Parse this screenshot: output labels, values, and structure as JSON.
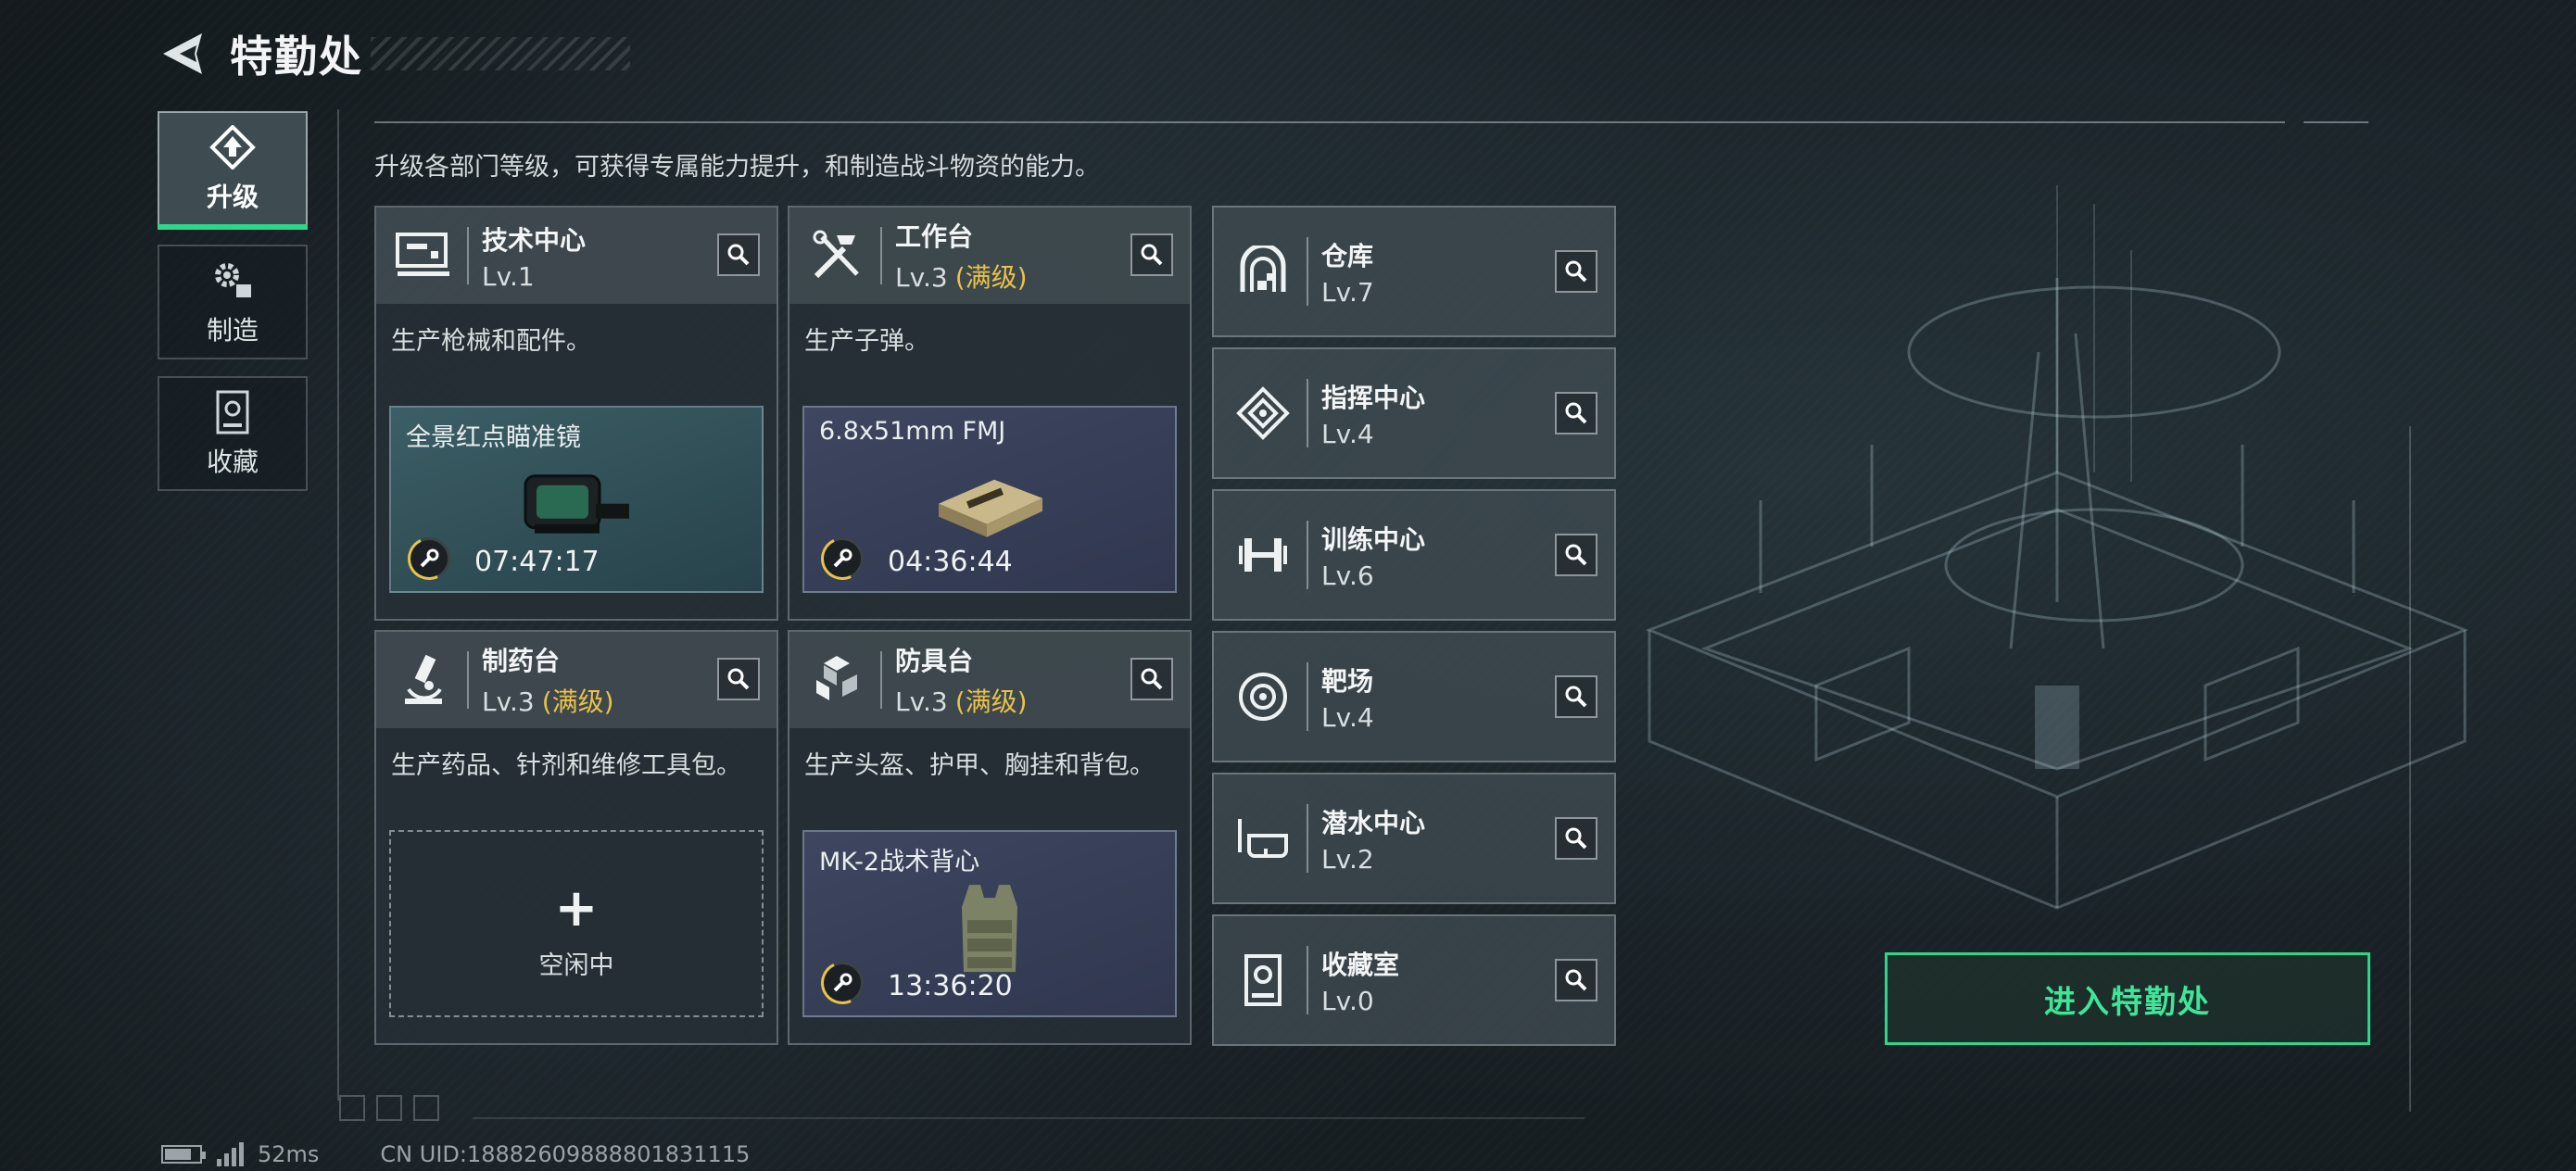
{
  "header": {
    "title": "特勤处",
    "back_icon": "back-arrow-icon"
  },
  "tabs": [
    {
      "label": "升级",
      "icon": "upgrade-icon",
      "active": true
    },
    {
      "label": "制造",
      "icon": "gears-icon",
      "active": false
    },
    {
      "label": "收藏",
      "icon": "collection-icon",
      "active": false
    }
  ],
  "description": "升级各部门等级，可获得专属能力提升，和制造战斗物资的能力。",
  "facilities": [
    {
      "name": "技术中心",
      "level": "Lv.1",
      "maxed": "",
      "icon": "monitor-icon",
      "desc": "生产枪械和配件。",
      "slot": {
        "item": "全景红点瞄准镜",
        "timer": "07:47:17",
        "item_icon": "red-dot-sight-icon"
      }
    },
    {
      "name": "工作台",
      "level": "Lv.3",
      "maxed": "(满级)",
      "icon": "tools-icon",
      "desc": "生产子弹。",
      "slot": {
        "item": "6.8x51mm FMJ",
        "timer": "04:36:44",
        "item_icon": "ammo-box-icon"
      }
    },
    {
      "name": "制药台",
      "level": "Lv.3",
      "maxed": "(满级)",
      "icon": "microscope-icon",
      "desc": "生产药品、针剂和维修工具包。",
      "slot": {
        "empty": true,
        "empty_label": "空闲中"
      }
    },
    {
      "name": "防具台",
      "level": "Lv.3",
      "maxed": "(满级)",
      "icon": "cubes-icon",
      "desc": "生产头盔、护甲、胸挂和背包。",
      "slot": {
        "item": "MK-2战术背心",
        "timer": "13:36:20",
        "item_icon": "tactical-vest-icon"
      }
    }
  ],
  "side_facilities": [
    {
      "name": "仓库",
      "level": "Lv.7",
      "icon": "warehouse-icon"
    },
    {
      "name": "指挥中心",
      "level": "Lv.4",
      "icon": "command-icon"
    },
    {
      "name": "训练中心",
      "level": "Lv.6",
      "icon": "dumbbell-icon"
    },
    {
      "name": "靶场",
      "level": "Lv.4",
      "icon": "target-icon"
    },
    {
      "name": "潜水中心",
      "level": "Lv.2",
      "icon": "diving-mask-icon"
    },
    {
      "name": "收藏室",
      "level": "Lv.0",
      "icon": "collection-room-icon"
    }
  ],
  "enter_button": "进入特勤处",
  "status": {
    "ping": "52ms",
    "uid": "CN UID:18882609888801831115"
  },
  "colors": {
    "accent": "#2fd68a",
    "maxed": "#e8c24a"
  }
}
